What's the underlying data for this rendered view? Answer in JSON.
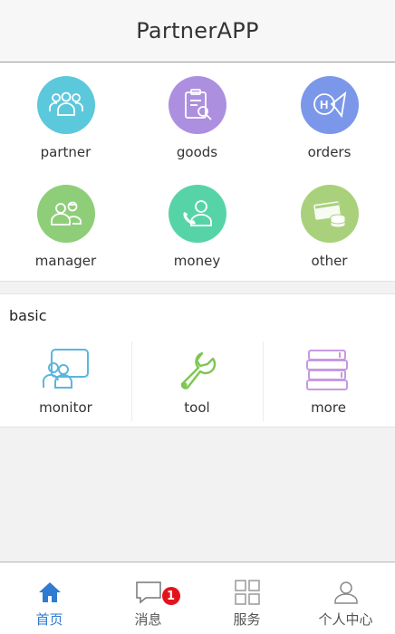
{
  "header": {
    "title": "PartnerAPP"
  },
  "grid": {
    "items": [
      {
        "label": "partner",
        "icon": "partner-icon",
        "color": "#5cc8dc"
      },
      {
        "label": "goods",
        "icon": "goods-icon",
        "color": "#ad8fe0"
      },
      {
        "label": "orders",
        "icon": "orders-icon",
        "color": "#7b97ea"
      },
      {
        "label": "manager",
        "icon": "manager-icon",
        "color": "#8fce79"
      },
      {
        "label": "money",
        "icon": "money-icon",
        "color": "#57d4a7"
      },
      {
        "label": "other",
        "icon": "other-icon",
        "color": "#a9d17c"
      }
    ]
  },
  "basic": {
    "title": "basic",
    "items": [
      {
        "label": "monitor",
        "icon": "monitor-icon",
        "color": "#5bb6dd"
      },
      {
        "label": "tool",
        "icon": "wrench-icon",
        "color": "#7dc653"
      },
      {
        "label": "more",
        "icon": "books-icon",
        "color": "#c69ae2"
      }
    ]
  },
  "tabbar": {
    "items": [
      {
        "label": "首页",
        "icon": "home-icon",
        "active": true
      },
      {
        "label": "消息",
        "icon": "message-icon",
        "badge": "1"
      },
      {
        "label": "服务",
        "icon": "grid-icon"
      },
      {
        "label": "个人中心",
        "icon": "user-icon"
      }
    ],
    "active_color": "#2f7bd1",
    "badge_color": "#e3131b"
  }
}
